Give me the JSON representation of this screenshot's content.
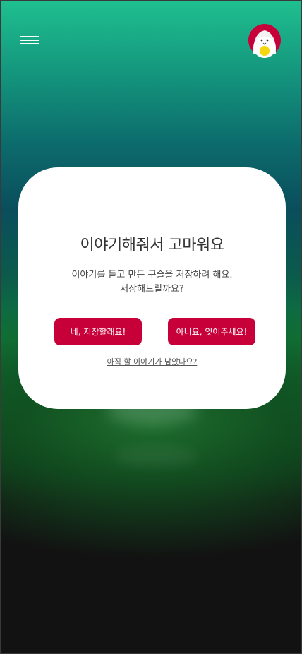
{
  "header": {
    "menu_icon": "hamburger-menu-icon",
    "avatar_icon": "chick-character-avatar-icon"
  },
  "dialog": {
    "title": "이야기해줘서 고마워요",
    "description_line1": "이야기를 듣고 만든 구슬을 저장하려 해요.",
    "description_line2": "저장해드릴까요?",
    "confirm_label": "네, 저장할래요!",
    "decline_label": "아니요, 잊어주세요!",
    "continue_link": "아직 할 이야기가 남았나요?"
  },
  "colors": {
    "accent": "#c8003a",
    "background_top": "#1fbf8f",
    "background_bottom": "#121212"
  }
}
